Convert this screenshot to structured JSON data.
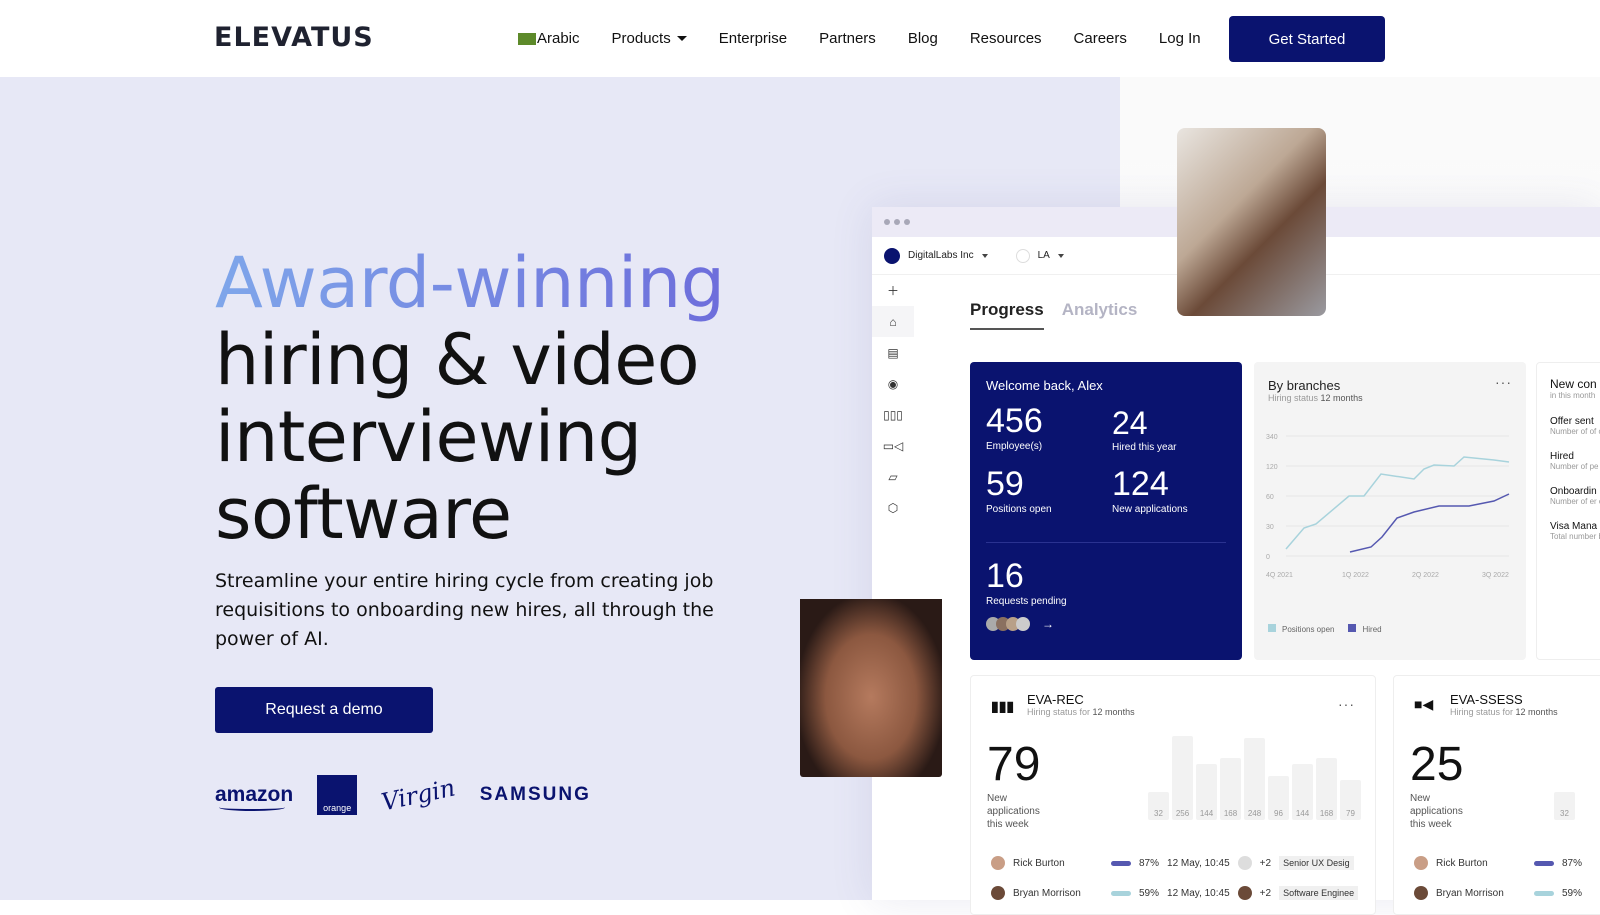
{
  "nav": {
    "logo": "ELEVATUS",
    "items": [
      "Arabic",
      "Products",
      "Enterprise",
      "Partners",
      "Blog",
      "Resources",
      "Careers",
      "Log In"
    ],
    "cta": "Get Started"
  },
  "hero": {
    "headline_accent": "Award-winning",
    "headline_rest": [
      "hiring & video",
      "interviewing",
      "software"
    ],
    "subtitle": "Streamline your entire hiring cycle from creating job requisitions to onboarding new hires, all through the power of AI.",
    "cta": "Request a demo",
    "logos": [
      "amazon",
      "orange",
      "Virgin",
      "SAMSUNG"
    ]
  },
  "dashboard": {
    "org": "DigitalLabs Inc",
    "location": "LA",
    "tabs": [
      "Progress",
      "Analytics"
    ],
    "sidebar_icons": [
      "plus-icon",
      "home-icon",
      "layout-icon",
      "target-icon",
      "pipeline-icon",
      "video-icon",
      "chat-icon",
      "settings-icon"
    ],
    "welcome": {
      "title": "Welcome back, Alex",
      "stats": [
        {
          "value": "456",
          "label": "Employee(s)"
        },
        {
          "value": "24",
          "label": "Hired this year"
        },
        {
          "value": "59",
          "label": "Positions open"
        },
        {
          "value": "124",
          "label": "New applications"
        },
        {
          "value": "16",
          "label": "Requests pending"
        }
      ]
    },
    "branches": {
      "title": "By branches",
      "subtitle_prefix": "Hiring status",
      "subtitle_period": "12 months",
      "y_ticks": [
        "340",
        "120",
        "60",
        "30",
        "0"
      ],
      "x_ticks": [
        "4Q 2021",
        "1Q 2022",
        "2Q 2022",
        "3Q 2022"
      ],
      "legend": [
        "Positions open",
        "Hired"
      ],
      "colors": {
        "positions": "#a8d3dc",
        "hired": "#5558b0"
      }
    },
    "new_con": {
      "title": "New con",
      "subtitle": "in this month",
      "items": [
        {
          "title": "Offer sent",
          "desc": "Number of of candidates"
        },
        {
          "title": "Hired",
          "desc": "Number of pe selected peri"
        },
        {
          "title": "Onboardin",
          "desc": "Number of er onboarding s"
        },
        {
          "title": "Visa Mana",
          "desc": "Total number being procee"
        }
      ]
    },
    "eva_rec": {
      "title": "EVA-REC",
      "subtitle_prefix": "Hiring status for",
      "subtitle_period": "12 months",
      "value": "79",
      "label": "New applications this week",
      "bars": [
        32,
        256,
        144,
        168,
        248,
        96,
        144,
        168,
        79
      ],
      "rows": [
        {
          "name": "Rick Burton",
          "pct": "87%",
          "date": "12 May, 10:45",
          "extra": "+2",
          "role": "Senior UX Desig"
        },
        {
          "name": "Bryan Morrison",
          "pct": "59%",
          "date": "12 May, 10:45",
          "extra": "+2",
          "role": "Software Enginee"
        }
      ]
    },
    "eva_ssess": {
      "title": "EVA-SSESS",
      "subtitle_prefix": "Hiring status for",
      "subtitle_period": "12 months",
      "value": "25",
      "label": "New applications this week",
      "bars": [
        32
      ],
      "rows": [
        {
          "name": "Rick Burton",
          "pct": "87%"
        },
        {
          "name": "Bryan Morrison",
          "pct": "59%"
        }
      ]
    }
  }
}
